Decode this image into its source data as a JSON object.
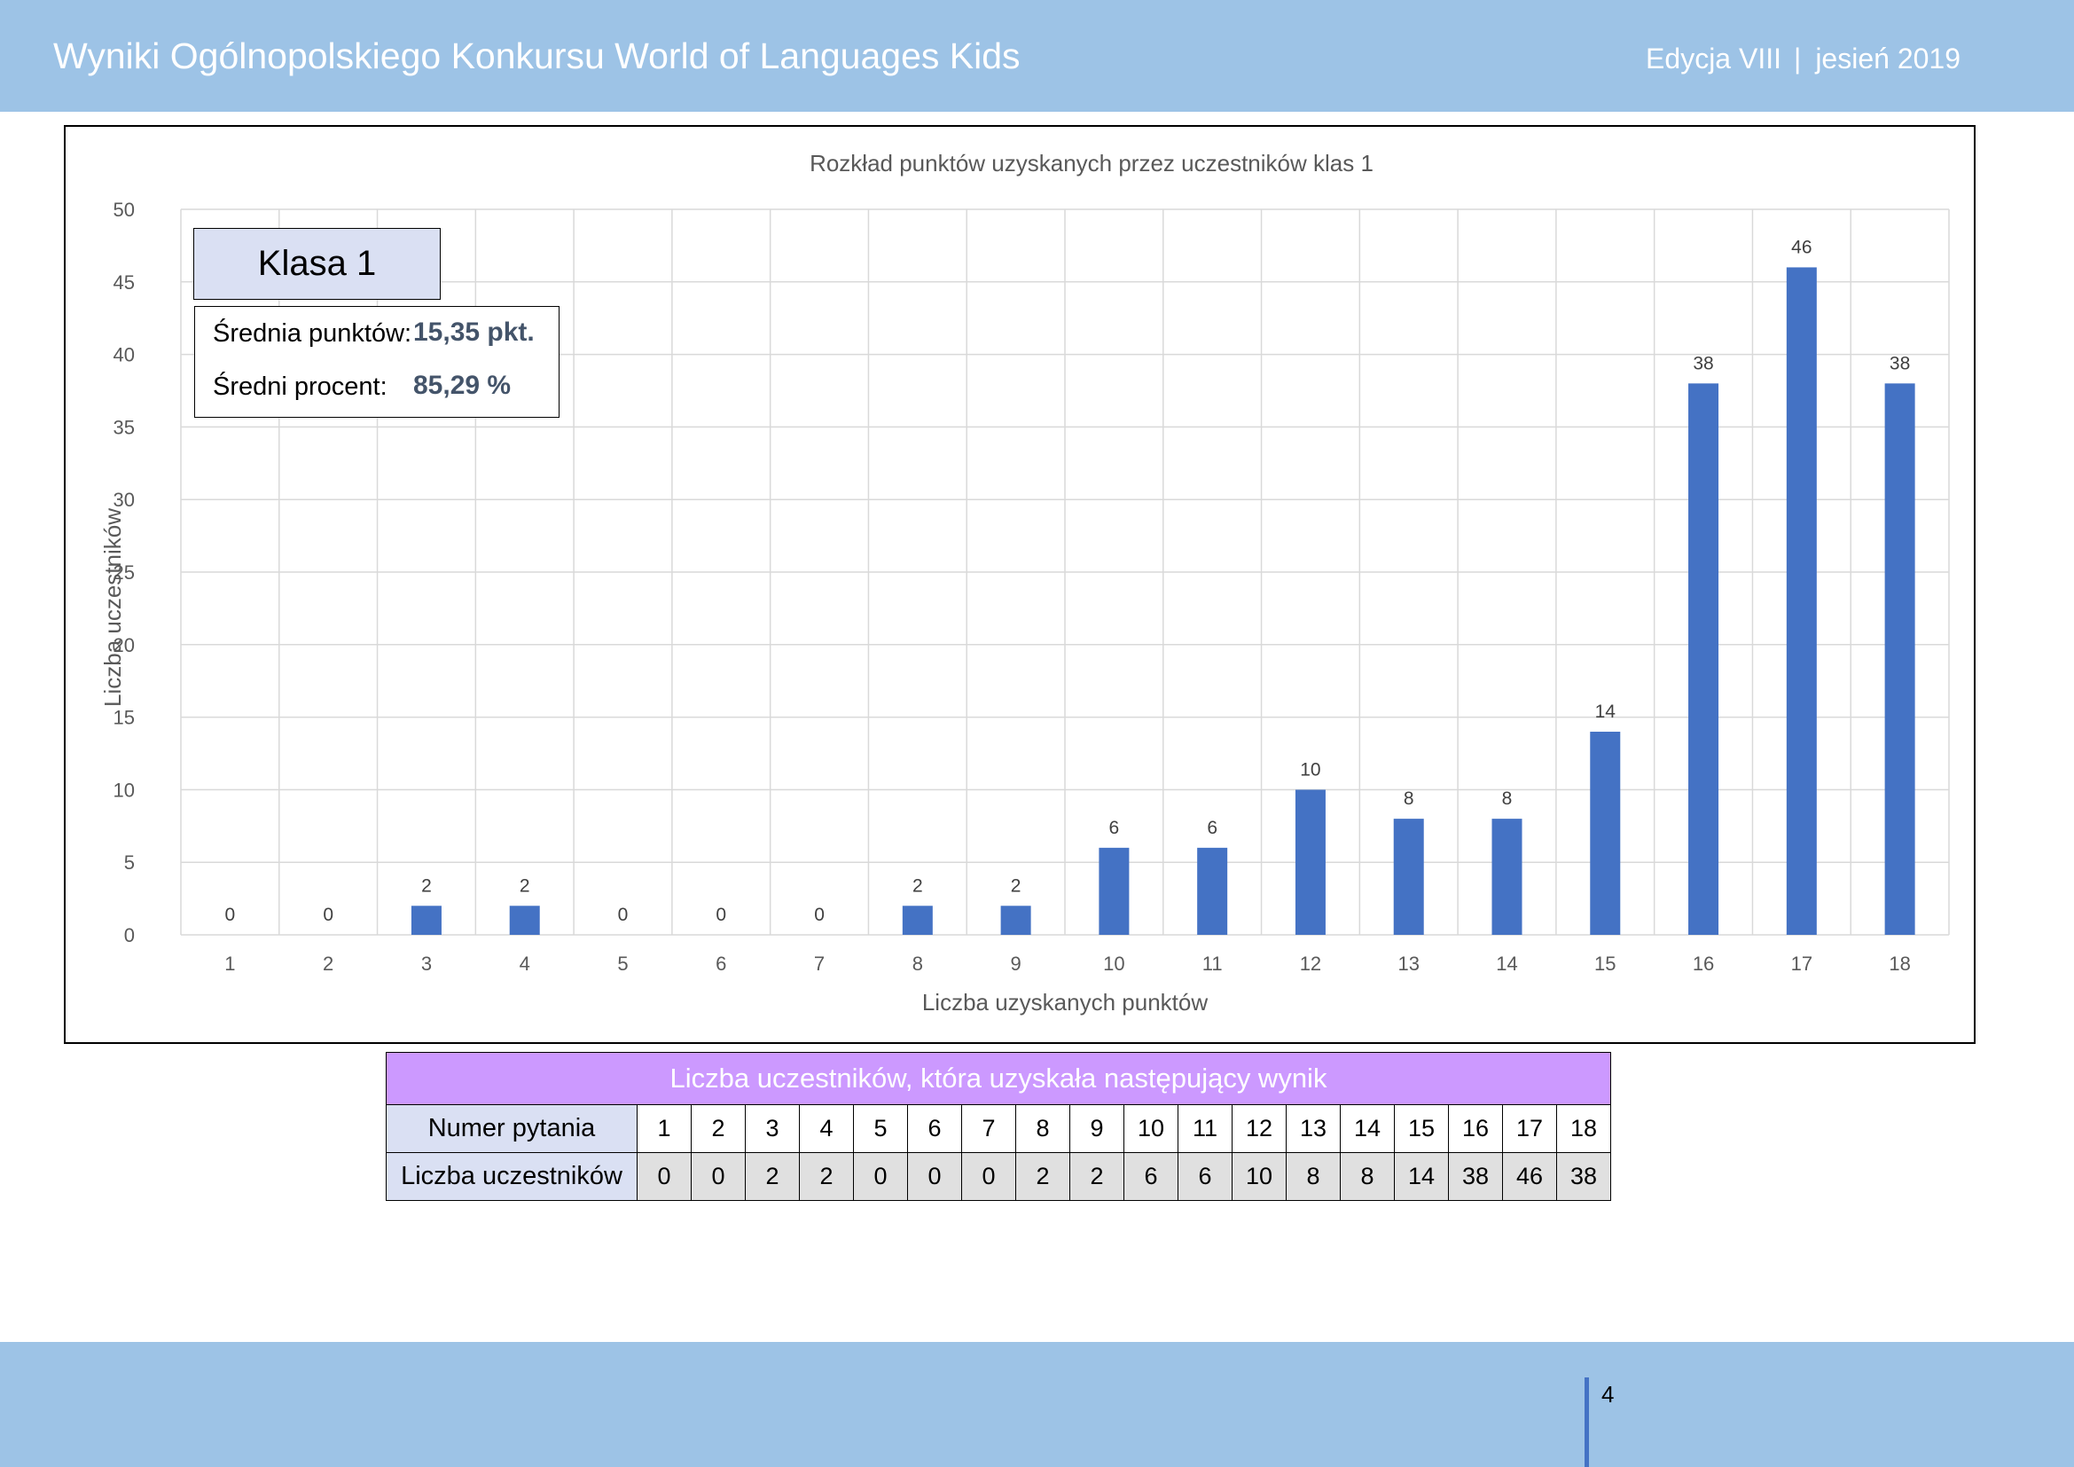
{
  "header": {
    "title": "Wyniki Ogólnopolskiego Konkursu World of Languages Kids",
    "edition": "Edycja VIII",
    "separator": "|",
    "season": "jesień 2019"
  },
  "info": {
    "class_label": "Klasa 1",
    "avg_points_label": "Średnia punktów:",
    "avg_points_value": "15,35 pkt.",
    "avg_percent_label": "Średni procent:",
    "avg_percent_value": "85,29 %"
  },
  "chart_data": {
    "type": "bar",
    "title": "Rozkład punktów uzyskanych przez uczestników klas 1",
    "xlabel": "Liczba uzyskanych punktów",
    "ylabel": "Liczba uczestników",
    "categories": [
      "1",
      "2",
      "3",
      "4",
      "5",
      "6",
      "7",
      "8",
      "9",
      "10",
      "11",
      "12",
      "13",
      "14",
      "15",
      "16",
      "17",
      "18"
    ],
    "values": [
      0,
      0,
      2,
      2,
      0,
      0,
      0,
      2,
      2,
      6,
      6,
      10,
      8,
      8,
      14,
      38,
      46,
      38
    ],
    "ylim": [
      0,
      50
    ],
    "yticks": [
      0,
      5,
      10,
      15,
      20,
      25,
      30,
      35,
      40,
      45,
      50
    ],
    "grid": true,
    "data_labels": true,
    "bar_color": "#4472c4"
  },
  "table": {
    "title": "Liczba uczestników, która uzyskała następujący wynik",
    "row1_label": "Numer pytania",
    "row2_label": "Liczba uczestników",
    "numbers": [
      "1",
      "2",
      "3",
      "4",
      "5",
      "6",
      "7",
      "8",
      "9",
      "10",
      "11",
      "12",
      "13",
      "14",
      "15",
      "16",
      "17",
      "18"
    ],
    "counts": [
      "0",
      "0",
      "2",
      "2",
      "0",
      "0",
      "0",
      "2",
      "2",
      "6",
      "6",
      "10",
      "8",
      "8",
      "14",
      "38",
      "46",
      "38"
    ]
  },
  "footer": {
    "page_number": "4"
  },
  "colors": {
    "header_bg": "#9dc3e6",
    "table_title_bg": "#cc99ff",
    "label_bg": "#dae0f3",
    "value_color": "#44546a"
  }
}
